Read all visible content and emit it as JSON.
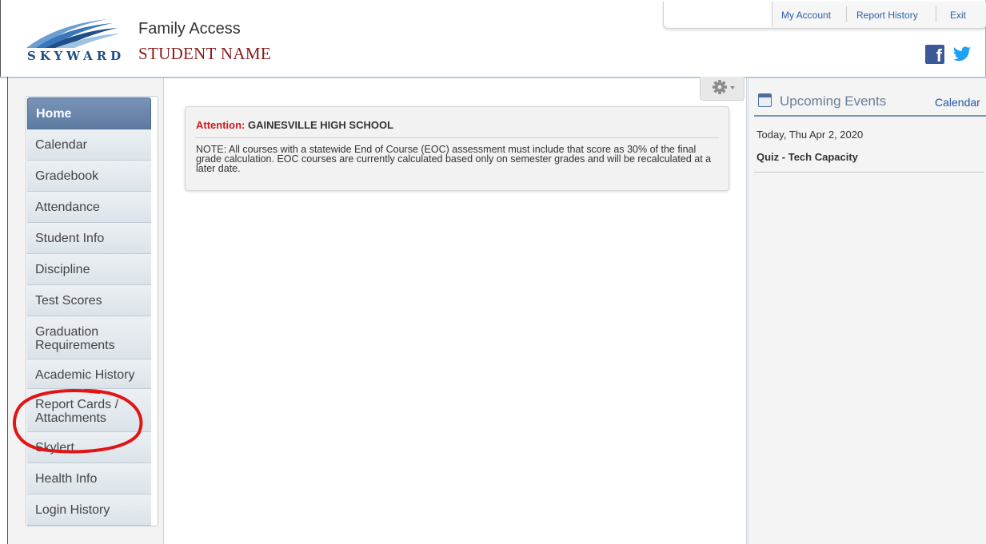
{
  "header": {
    "logo_text": "SKYWARD",
    "app_name": "Family Access",
    "student_name": "STUDENT NAME",
    "links": [
      "My Account",
      "Report History",
      "Exit"
    ],
    "social_icons": [
      "facebook-icon",
      "twitter-icon"
    ]
  },
  "sidebar": {
    "items": [
      {
        "label": "Home",
        "active": true
      },
      {
        "label": "Calendar"
      },
      {
        "label": "Gradebook"
      },
      {
        "label": "Attendance"
      },
      {
        "label": "Student Info"
      },
      {
        "label": "Discipline"
      },
      {
        "label": "Test Scores"
      },
      {
        "label": "Graduation Requirements"
      },
      {
        "label": "Academic History"
      },
      {
        "label": "Report Cards / Attachments"
      },
      {
        "label": "Skylert"
      },
      {
        "label": "Health Info"
      },
      {
        "label": "Login History"
      }
    ]
  },
  "main": {
    "gear_icon": "gear-icon",
    "alert": {
      "prefix": "Attention:",
      "school": "GAINESVILLE HIGH SCHOOL",
      "body": "NOTE: All courses with a statewide End of Course (EOC) assessment must include that score as 30% of the final grade calculation. EOC courses are currently calculated based only on semester grades and will be recalculated at a later date."
    }
  },
  "upcoming_events": {
    "title": "Upcoming Events",
    "calendar_link": "Calendar",
    "events": [
      {
        "date": "Today, Thu Apr 2, 2020",
        "title": "Quiz - Tech Capacity"
      }
    ]
  },
  "colors": {
    "brand_blue": "#1e4f86",
    "student_name": "#8b1a1a",
    "attention_red": "#d01b1b",
    "annotation_red": "#e01515",
    "nav_active": "#5e7aa2"
  }
}
